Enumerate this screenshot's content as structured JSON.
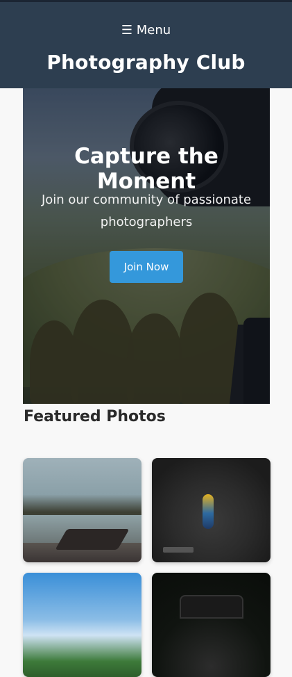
{
  "header": {
    "menu_label": "☰ Menu",
    "title": "Photography Club"
  },
  "hero": {
    "title": "Capture the Moment",
    "subtitle": "Join our community of passionate photographers",
    "cta_label": "Join Now"
  },
  "featured": {
    "title": "Featured Photos",
    "photos": [
      {
        "icon": "lake-boats-photo"
      },
      {
        "icon": "parrot-photo"
      },
      {
        "icon": "sky-landscape-photo"
      },
      {
        "icon": "camera-photo"
      }
    ]
  },
  "colors": {
    "header_bg": "#2d3e50",
    "accent": "#3498db",
    "page_bg": "#f8f8f8"
  }
}
